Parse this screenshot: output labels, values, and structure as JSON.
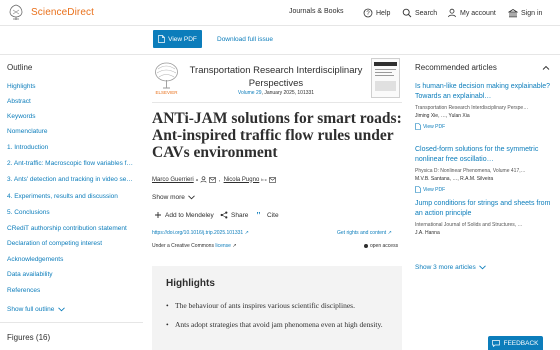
{
  "header": {
    "brand": "ScienceDirect",
    "nav": [
      {
        "label": "Journals & Books",
        "icon": ""
      },
      {
        "label": "Help",
        "icon": "help-icon"
      },
      {
        "label": "Search",
        "icon": "search-icon"
      },
      {
        "label": "My account",
        "icon": "user-icon"
      },
      {
        "label": "Sign in",
        "icon": "institution-icon"
      }
    ]
  },
  "toolbar": {
    "view_pdf": "View PDF",
    "download_issue": "Download full issue"
  },
  "outline": {
    "heading": "Outline",
    "items": [
      "Highlights",
      "Abstract",
      "Keywords",
      "Nomenclature",
      "1. Introduction",
      "2. Ant-traffic: Macroscopic flow variables f…",
      "3. Ants' detection and tracking in video se…",
      "4. Experiments, results and discussion",
      "5. Conclusions",
      "CRediT authorship contribution statement",
      "Declaration of competing interest",
      "Acknowledgements",
      "Data availability",
      "References"
    ],
    "show_full": "Show full outline",
    "figures": "Figures (16)"
  },
  "article": {
    "journal": "Transportation Research Interdisciplinary Perspectives",
    "volume": "Volume 29",
    "issue_meta": ", January 2025, 101331",
    "elsevier": "ELSEVIER",
    "title": "ANTi-JAM solutions for smart roads: Ant-inspired traffic flow rules under CAVs environment",
    "authors": [
      {
        "name": "Marco Guerrieri",
        "sup": "a"
      },
      {
        "name": "Nicola Pugno",
        "sup": "b c"
      }
    ],
    "show_more": "Show more",
    "actions": [
      {
        "label": "Add to Mendeley",
        "icon": "plus-icon"
      },
      {
        "label": "Share",
        "icon": "share-icon"
      },
      {
        "label": "Cite",
        "icon": "quote-icon"
      }
    ],
    "doi": "https://doi.org/10.1016/j.trip.2025.101331",
    "rights": "Get rights and content",
    "license_prefix": "Under a Creative Commons ",
    "license_link": "license",
    "open_access": "open access"
  },
  "highlights": {
    "title": "Highlights",
    "items": [
      "The behaviour of ants inspires various scientific disciplines.",
      "Ants adopt strategies that avoid jam phenomena even at high density."
    ]
  },
  "recommended": {
    "heading": "Recommended articles",
    "view_pdf": "View PDF",
    "items": [
      {
        "title": "Is human-like decision making explainable? Towards an explainabl…",
        "source": "Transportation Research Interdisciplinary Perspe…",
        "authors": "Jiming Xie, …, Yulan Xia"
      },
      {
        "title": "Closed-form solutions for the symmetric nonlinear free oscillatio…",
        "source": "Physica D: Nonlinear Phenomena, Volume 417,…",
        "authors": "M.V.B. Santana, …, R.A.M. Silveira"
      },
      {
        "title": "Jump conditions for strings and sheets from an action principle",
        "source": "International Journal of Solids and Structures, …",
        "authors": "J.A. Hanna"
      }
    ],
    "show_more": "Show 3 more articles"
  },
  "feedback": "FEEDBACK",
  "colors": {
    "brand_orange": "#e9711c",
    "link_blue": "#0c7dbb",
    "highlight_bg": "#f3f3f3"
  }
}
